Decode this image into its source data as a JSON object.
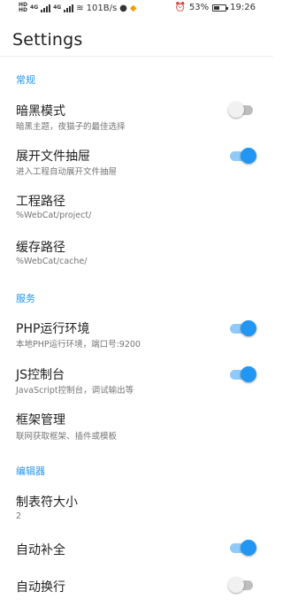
{
  "status_bar": {
    "network_1": "4G",
    "network_2": "4G",
    "speed": "101B/s",
    "battery": "53%",
    "battery_level": 0.53,
    "time": "19:26",
    "icons": [
      "signal-icon",
      "wifi-icon",
      "qq-icon",
      "app-icon",
      "alarm-icon",
      "battery-icon"
    ]
  },
  "app_bar": {
    "title": "Settings"
  },
  "sections": {
    "general": "常规",
    "service": "服务",
    "editor": "编辑器"
  },
  "items": {
    "dark_mode": {
      "title": "暗黑模式",
      "subtitle": "暗黑主题，夜猫子的最佳选择",
      "checked": false
    },
    "drawer": {
      "title": "展开文件抽屉",
      "subtitle": "进入工程自动展开文件抽屉",
      "checked": true
    },
    "project_path": {
      "title": "工程路径",
      "subtitle": "%WebCat/project/"
    },
    "cache_path": {
      "title": "缓存路径",
      "subtitle": "%WebCat/cache/"
    },
    "php_env": {
      "title": "PHP运行环境",
      "subtitle": "本地PHP运行环境，端口号:9200",
      "checked": true
    },
    "js_console": {
      "title": "JS控制台",
      "subtitle": "JavaScript控制台，调试输出等",
      "checked": true
    },
    "frameworks": {
      "title": "框架管理",
      "subtitle": "联网获取框架、插件或模板"
    },
    "tab_size": {
      "title": "制表符大小",
      "subtitle": "2"
    },
    "autocomplete": {
      "title": "自动补全",
      "checked": true
    },
    "word_wrap": {
      "title": "自动换行",
      "checked": false
    }
  },
  "colors": {
    "accent": "#2196f3",
    "accent_track": "#90caf9",
    "off_track": "#bdbdbd"
  }
}
